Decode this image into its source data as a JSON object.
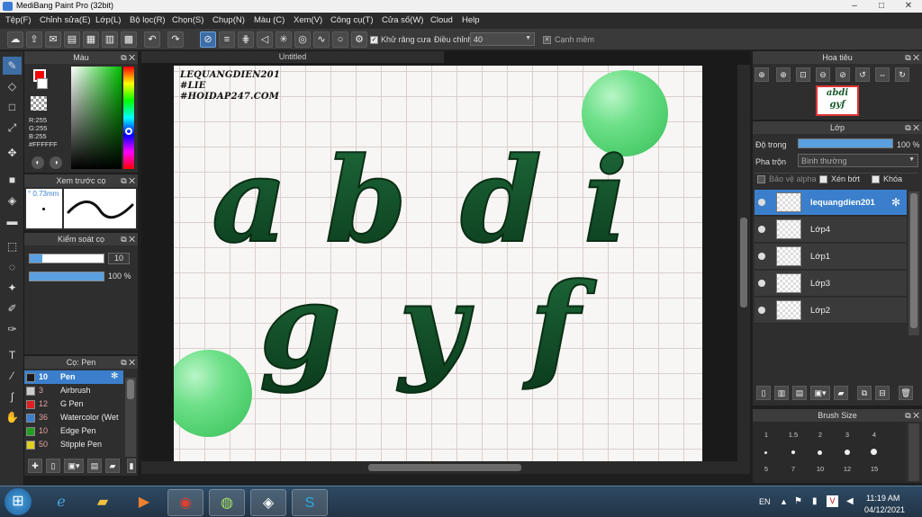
{
  "window": {
    "title": "MediBang Paint Pro (32bit)"
  },
  "menu": [
    "Tệp(F)",
    "Chỉnh sửa(E)",
    "Lớp(L)",
    "Bộ lọc(R)",
    "Chọn(S)",
    "Chụp(N)",
    "Màu (C)",
    "Xem(V)",
    "Công cụ(T)",
    "Cửa số(W)",
    "Cloud",
    "Help"
  ],
  "toolbar": {
    "antialias_label": "Khử răng cưa",
    "adjust_label": "Điều chỉnh",
    "adjust_value": "40",
    "sharp_edge_label": "Cạnh mềm",
    "icons": [
      "cloud-icon",
      "export-icon",
      "chat-icon",
      "layers-icon",
      "doc-icon",
      "grid-icon",
      "film-icon",
      "window-icon",
      "undo-icon",
      "redo-icon",
      "no-snap-icon",
      "parallel-icon",
      "cross-icon",
      "vanish-icon",
      "radial-icon",
      "concentric-icon",
      "curve-icon",
      "circle-icon",
      "settings-icon"
    ]
  },
  "color_panel": {
    "title": "Màu",
    "r": "R:255",
    "g": "G:255",
    "b": "B:255",
    "hex": "#FFFFFF",
    "primary": "#ff0000",
    "secondary": "#ffffff"
  },
  "preview_panel": {
    "title": "Xem trước cọ",
    "size": "0.73mm"
  },
  "brush_control_panel": {
    "title": "Kiểm soát cọ",
    "size_value": "10",
    "opacity_value": "100 %"
  },
  "brush_list": {
    "title": "Cọ: Pen",
    "items": [
      {
        "size": "10",
        "name": "Pen",
        "color": "#1a1a1a",
        "selected": true
      },
      {
        "size": "3",
        "name": "Airbrush",
        "color": "#cccccc"
      },
      {
        "size": "12",
        "name": "G Pen",
        "color": "#e02020"
      },
      {
        "size": "36",
        "name": "Watercolor (Wet",
        "color": "#3b7fcc"
      },
      {
        "size": "10",
        "name": "Edge Pen",
        "color": "#20a020"
      },
      {
        "size": "50",
        "name": "Stipple Pen",
        "color": "#e0d020"
      }
    ]
  },
  "document": {
    "tab": "Untitled",
    "watermark": [
      "LEQUANGDIEN201",
      "#LIE",
      "#HOIDAP247.COM"
    ],
    "letters_row1": [
      "a",
      "b",
      "d",
      "i"
    ],
    "letters_row2": [
      "g",
      "y",
      "f"
    ]
  },
  "navigator_panel": {
    "title": "Hoa tiêu",
    "thumb_row1": "abdi",
    "thumb_row2": "gyf"
  },
  "layer_panel": {
    "title": "Lớp",
    "opacity_label": "Độ trong",
    "opacity_value": "100 %",
    "opacity_fraction": 1.0,
    "blend_label": "Pha trộn",
    "blend_value": "Bình thường",
    "protect_alpha": "Bảo vệ alpha",
    "clipping": "Xén bớt",
    "lock": "Khóa",
    "layers": [
      {
        "name": "lequangdien201",
        "selected": true
      },
      {
        "name": "Lớp4"
      },
      {
        "name": "Lớp1"
      },
      {
        "name": "Lớp3"
      },
      {
        "name": "Lớp2"
      }
    ]
  },
  "brush_size_panel": {
    "title": "Brush Size",
    "row1": [
      "1",
      "1.5",
      "2",
      "3",
      "4"
    ],
    "row2": [
      "5",
      "7",
      "10",
      "12",
      "15"
    ]
  },
  "taskbar": {
    "lang": "EN",
    "time": "11:19 AM",
    "date": "04/12/2021",
    "apps": [
      "start-orb-icon",
      "ie-icon",
      "explorer-icon",
      "media-icon",
      "chrome-icon",
      "app-icon",
      "paint-icon",
      "skype-icon"
    ]
  }
}
